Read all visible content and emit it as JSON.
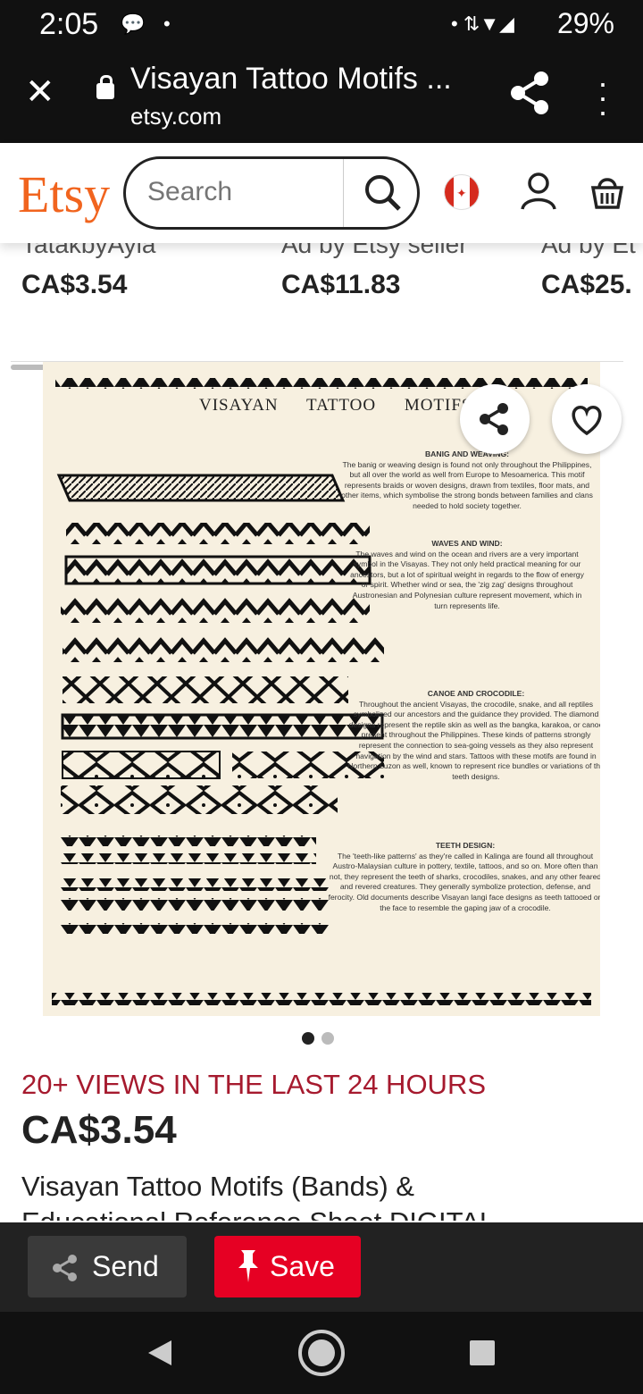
{
  "status": {
    "time": "2:05",
    "battery": "29%"
  },
  "browser": {
    "title": "Visayan Tattoo Motifs ...",
    "url": "etsy.com"
  },
  "header": {
    "logo": "Etsy",
    "search_placeholder": "Search"
  },
  "carousel": [
    {
      "sub": "TatakbyAyla",
      "price": "CA$3.54"
    },
    {
      "sub": "Ad by Etsy seller",
      "price": "CA$11.83"
    },
    {
      "sub": "Ad by Et",
      "price": "CA$25."
    }
  ],
  "poster": {
    "title": "VISAYAN TATTOO MOTIFS",
    "sections": [
      {
        "heading": "BANIG AND WEAVING:",
        "body": "The banig or weaving design is found not only throughout the Philippines, but all over the world as well from Europe to Mesoamerica. This motif represents braids or woven designs, drawn from textiles, floor mats, and other items, which symbolise the strong bonds between families and clans needed to hold society together."
      },
      {
        "heading": "WAVES AND WIND:",
        "body": "The waves and wind on the ocean and rivers are a very important symbol in the Visayas. They not only held practical meaning for our ancestors, but a lot of spiritual weight in regards to the flow of energy or spirit. Whether wind or sea, the 'zig zag' designs throughout Austronesian and Polynesian culture represent movement, which in turn represents life."
      },
      {
        "heading": "CANOE AND CROCODILE:",
        "body": "Throughout the ancient Visayas, the crocodile, snake, and all reptiles symbolized our ancestors and the guidance they provided. The diamond designs represent the reptile skin as well as the bangka, karakoa, or canoe present throughout the Philippines. These kinds of patterns strongly represent the connection to sea-going vessels as they also represent navigation by the wind and stars. Tattoos with these motifs are found in Northern Luzon as well, known to represent rice bundles or variations of the teeth designs."
      },
      {
        "heading": "TEETH DESIGN:",
        "body": "The 'teeth-like patterns' as they're called in Kalinga are found all throughout Austro-Malaysian culture in pottery, textile, tattoos, and so on. More often than not, they represent the teeth of sharks, crocodiles, snakes, and any other feared and revered creatures. They generally symbolize protection, defense, and ferocity. Old documents describe Visayan langi face designs as teeth tattooed on the face to resemble the gaping jaw of a crocodile."
      }
    ]
  },
  "image_pager": {
    "count": 2,
    "active": 1
  },
  "listing": {
    "views": "20+ VIEWS IN THE LAST 24 HOURS",
    "price": "CA$3.54",
    "title": "Visayan Tattoo Motifs (Bands) &",
    "title_line2": "Educational Reference Sheet DIGITAL"
  },
  "actions": {
    "send": "Send",
    "save": "Save"
  },
  "colors": {
    "etsy_orange": "#f1641e",
    "views_red": "#a61a2e",
    "save_red": "#e60023"
  }
}
